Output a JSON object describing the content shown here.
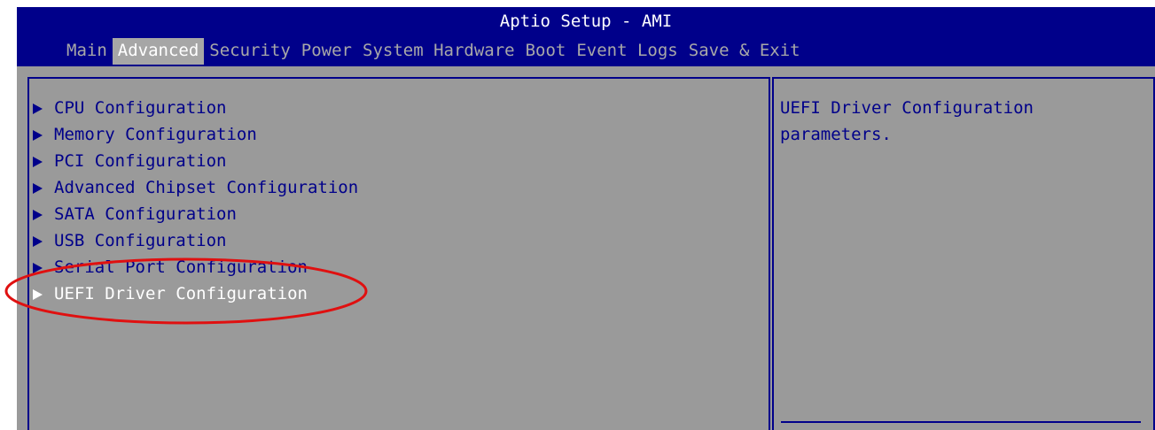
{
  "app_title": "Aptio Setup - AMI",
  "tabs": [
    {
      "label": "Main"
    },
    {
      "label": "Advanced"
    },
    {
      "label": "Security"
    },
    {
      "label": "Power"
    },
    {
      "label": "System Hardware"
    },
    {
      "label": "Boot"
    },
    {
      "label": "Event Logs"
    },
    {
      "label": "Save & Exit"
    }
  ],
  "active_tab": "Advanced",
  "menu": [
    {
      "label": "CPU Configuration"
    },
    {
      "label": "Memory Configuration"
    },
    {
      "label": "PCI Configuration"
    },
    {
      "label": "Advanced Chipset Configuration"
    },
    {
      "label": "SATA Configuration"
    },
    {
      "label": "USB Configuration"
    },
    {
      "label": "Serial Port Configuration"
    },
    {
      "label": "UEFI Driver Configuration"
    }
  ],
  "selected_item": "UEFI Driver Configuration",
  "help_text": "UEFI Driver Configuration parameters.",
  "icons": {
    "submenu": "triangle-right-icon",
    "annotation": "red-ellipse-highlight"
  },
  "colors": {
    "header_background": "#00008a",
    "body_background": "#9a9a9a",
    "text_primary": "#00008a",
    "text_selected": "#ffffff",
    "tab_inactive": "#a8a8a8",
    "annotation": "#e01010"
  }
}
